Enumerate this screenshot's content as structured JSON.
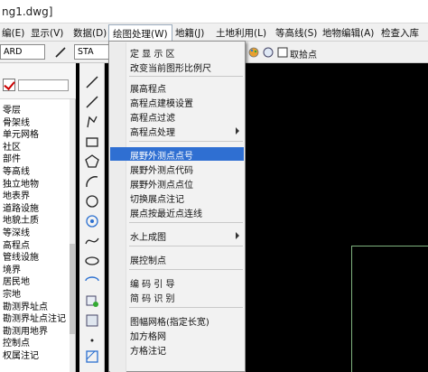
{
  "window": {
    "title": "ng1.dwg]"
  },
  "menubar": {
    "items": [
      {
        "label": "编(E)"
      },
      {
        "label": "显示(V)"
      },
      {
        "label": "数据(D)"
      },
      {
        "label": "绘图处理(W)"
      },
      {
        "label": "地籍(J)"
      },
      {
        "label": "土地利用(L)"
      },
      {
        "label": "等高线(S)"
      },
      {
        "label": "地物编辑(A)"
      },
      {
        "label": "检查入库"
      }
    ]
  },
  "toolbar": {
    "layer_combo": "ARD",
    "style_combo": "STA",
    "pick_point_label": "取拾点"
  },
  "layers": {
    "items": [
      "零层",
      "骨架线",
      "单元网格",
      "社区",
      "部件",
      "等高线",
      "独立地物",
      "地表界",
      "道路设施",
      "地貌土质",
      "等深线",
      "高程点",
      "管线设施",
      "境界",
      "居民地",
      "宗地",
      "勘测界址点",
      "勘测界址点注记",
      "勘测用地界",
      "控制点",
      "权属注记"
    ]
  },
  "dropdown": {
    "items": [
      {
        "label": "定 显 示 区",
        "has_submenu": false,
        "highlighted": false
      },
      {
        "label": "改变当前图形比例尺",
        "has_submenu": false,
        "highlighted": false
      },
      {
        "label": "展高程点",
        "has_submenu": false,
        "highlighted": false
      },
      {
        "label": "高程点建模设置",
        "has_submenu": false,
        "highlighted": false
      },
      {
        "label": "高程点过滤",
        "has_submenu": false,
        "highlighted": false
      },
      {
        "label": "高程点处理",
        "has_submenu": true,
        "highlighted": false
      },
      {
        "label": "展野外测点点号",
        "has_submenu": false,
        "highlighted": true
      },
      {
        "label": "展野外测点代码",
        "has_submenu": false,
        "highlighted": false
      },
      {
        "label": "展野外测点点位",
        "has_submenu": false,
        "highlighted": false
      },
      {
        "label": "切换展点注记",
        "has_submenu": false,
        "highlighted": false
      },
      {
        "label": "展点按最近点连线",
        "has_submenu": false,
        "highlighted": false
      },
      {
        "label": "水上成图",
        "has_submenu": true,
        "highlighted": false
      },
      {
        "label": "展控制点",
        "has_submenu": false,
        "highlighted": false
      },
      {
        "label": "编 码 引 导",
        "has_submenu": false,
        "highlighted": false
      },
      {
        "label": "简 码 识 别",
        "has_submenu": false,
        "highlighted": false
      },
      {
        "label": "图幅网格(指定长宽)",
        "has_submenu": false,
        "highlighted": false
      },
      {
        "label": "加方格网",
        "has_submenu": false,
        "highlighted": false
      },
      {
        "label": "方格注记",
        "has_submenu": false,
        "highlighted": false
      }
    ]
  },
  "colors": {
    "highlight": "#2f6fd2",
    "canvas": "#000000",
    "menu_bg": "#f2f2f2",
    "frame_line": "#7fb37f"
  }
}
